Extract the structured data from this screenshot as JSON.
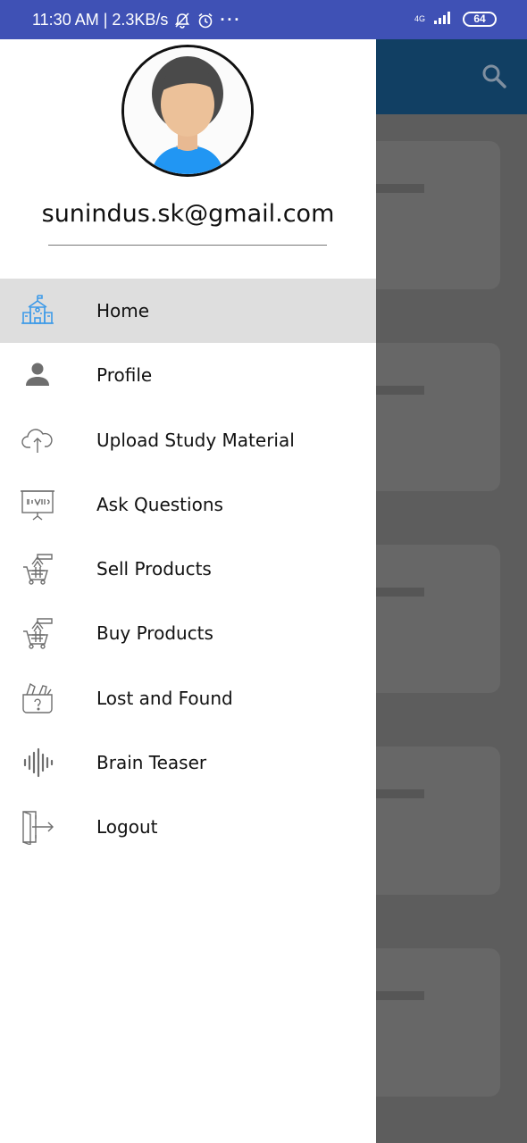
{
  "status_bar": {
    "time_speed": "11:30 AM | 2.3KB/s",
    "more": "···",
    "network": "4G",
    "battery": "64"
  },
  "drawer": {
    "email": "sunindus.sk@gmail.com",
    "menu": [
      {
        "label": "Home",
        "icon": "school-building-icon",
        "active": true
      },
      {
        "label": "Profile",
        "icon": "person-icon"
      },
      {
        "label": "Upload Study Material",
        "icon": "cloud-upload-icon"
      },
      {
        "label": "Ask Questions",
        "icon": "presentation-board-icon"
      },
      {
        "label": "Sell Products",
        "icon": "shopping-cart-tag-icon"
      },
      {
        "label": "Buy Products",
        "icon": "shopping-cart-tag-icon"
      },
      {
        "label": "Lost and Found",
        "icon": "lost-found-box-icon"
      },
      {
        "label": "Brain Teaser",
        "icon": "sound-wave-icon"
      },
      {
        "label": "Logout",
        "icon": "logout-door-icon"
      }
    ]
  },
  "colors": {
    "status_bar": "#3f51b5",
    "app_header": "#113f63",
    "overlay": "#5d5d5d",
    "active_item": "#dedede",
    "avatar_shirt": "#2196f3"
  }
}
